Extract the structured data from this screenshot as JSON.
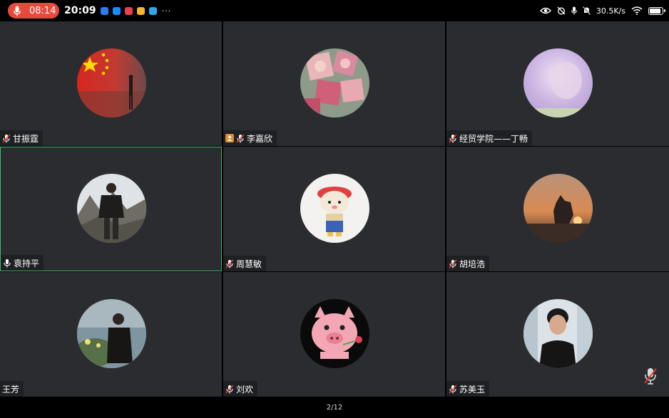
{
  "status_bar": {
    "recording_time": "08:14",
    "clock": "20:09",
    "more": "···",
    "network_speed": "30.5K/s",
    "battery_level": 0.9
  },
  "participants": [
    {
      "name": "甘振霆",
      "mic": "muted",
      "share": false,
      "theme": "flag"
    },
    {
      "name": "李嘉欣",
      "mic": "muted",
      "share": true,
      "theme": "pink"
    },
    {
      "name": "经贸学院——丁畅",
      "mic": "muted",
      "share": false,
      "theme": "lavender"
    },
    {
      "name": "袁持平",
      "mic": "on",
      "share": false,
      "theme": "mountain",
      "active": true
    },
    {
      "name": "周慧敏",
      "mic": "muted",
      "share": false,
      "theme": "doll"
    },
    {
      "name": "胡培浩",
      "mic": "muted",
      "share": false,
      "theme": "sunset"
    },
    {
      "name": "王芳",
      "mic": "none",
      "share": false,
      "theme": "lake"
    },
    {
      "name": "刘欢",
      "mic": "muted",
      "share": false,
      "theme": "pig"
    },
    {
      "name": "苏美玉",
      "mic": "muted",
      "share": false,
      "theme": "portrait"
    }
  ],
  "pagination": "2/12",
  "colors": {
    "tile_bg": "#2a2c2f",
    "active_border": "#3dbf63",
    "recording": "#e64a3c"
  }
}
